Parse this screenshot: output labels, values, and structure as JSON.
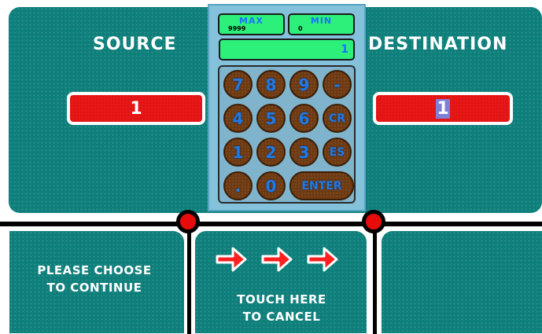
{
  "source": {
    "title": "SOURCE",
    "value": "1"
  },
  "destination": {
    "title": "DESTINATION",
    "value": "1"
  },
  "keypad": {
    "max_label": "MAX",
    "max_value": "9999",
    "min_label": "MIN",
    "min_value": "0",
    "display": "1",
    "keys": [
      "7",
      "8",
      "9",
      "-",
      "4",
      "5",
      "6",
      "CR",
      "1",
      "2",
      "3",
      "ES",
      ".",
      "0",
      "ENTER"
    ]
  },
  "prompt": {
    "line1": "PLEASE CHOOSE",
    "line2": "TO CONTINUE"
  },
  "cancel": {
    "line1": "TOUCH HERE",
    "line2": "TO CANCEL"
  },
  "colors": {
    "teal": "#0e7f7b",
    "field_red": "#e81616",
    "indicator_red": "#e80b0b",
    "keypad_green": "#2df07a",
    "key_text_blue": "#1e7ae8"
  }
}
